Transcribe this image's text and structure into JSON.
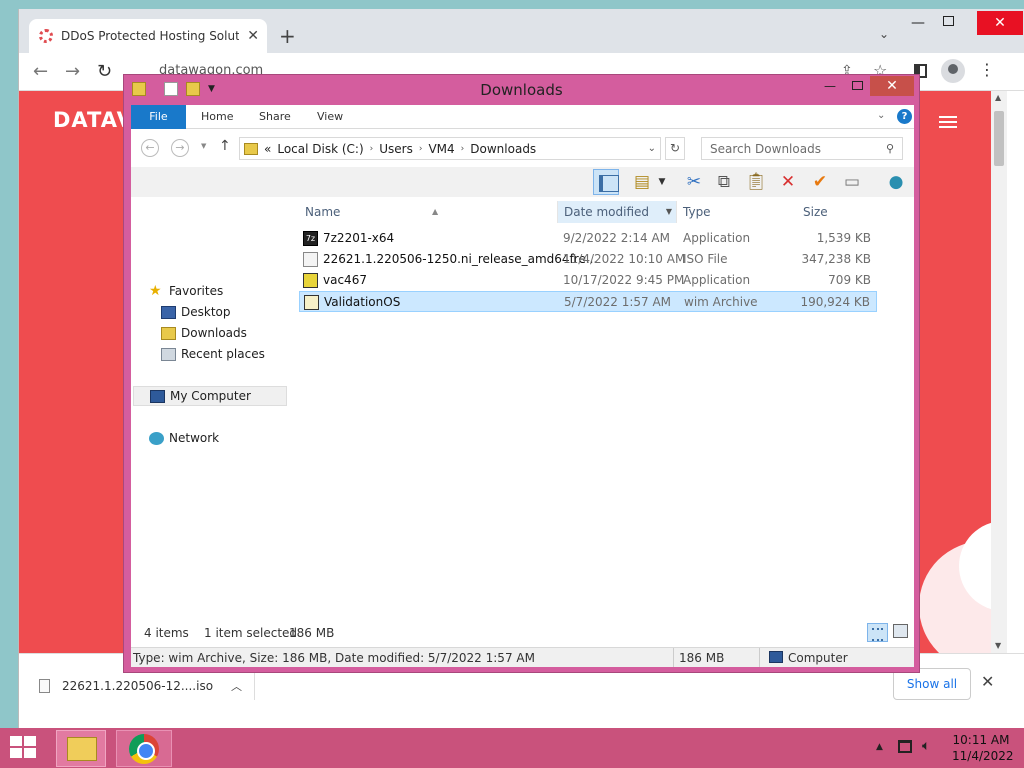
{
  "browser": {
    "tab_title": "DDoS Protected Hosting Solution",
    "tab_close": "✕",
    "new_tab": "+",
    "address": "datawagon.com",
    "site_logo": "DATAV"
  },
  "downloads_bar": {
    "file_name": "22621.1.220506-12....iso",
    "show_all": "Show all",
    "close": "✕"
  },
  "explorer": {
    "title": "Downloads",
    "ribbon_tabs": [
      "File",
      "Home",
      "Share",
      "View"
    ],
    "help": "?",
    "breadcrumb": {
      "prefix": "«",
      "items": [
        "Local Disk (C:)",
        "Users",
        "VM4",
        "Downloads"
      ]
    },
    "search_placeholder": "Search Downloads",
    "nav": {
      "favorites": "Favorites",
      "desktop": "Desktop",
      "downloads": "Downloads",
      "recent": "Recent places",
      "my_computer": "My Computer",
      "network": "Network"
    },
    "columns": {
      "name": "Name",
      "date": "Date modified",
      "type": "Type",
      "size": "Size"
    },
    "files": [
      {
        "name": "7z2201-x64",
        "date": "9/2/2022 2:14 AM",
        "type": "Application",
        "size": "1,539 KB"
      },
      {
        "name": "22621.1.220506-1250.ni_release_amd64fre...",
        "date": "11/4/2022 10:10 AM",
        "type": "ISO File",
        "size": "347,238 KB"
      },
      {
        "name": "vac467",
        "date": "10/17/2022 9:45 PM",
        "type": "Application",
        "size": "709 KB"
      },
      {
        "name": "ValidationOS",
        "date": "5/7/2022 1:57 AM",
        "type": "wim Archive",
        "size": "190,924 KB"
      }
    ],
    "status": {
      "item_count": "4 items",
      "selected": "1 item selected",
      "selected_size": "186 MB"
    },
    "info_bar": {
      "details": "Type: wim Archive, Size: 186 MB, Date modified: 5/7/2022 1:57 AM",
      "size": "186 MB",
      "location": "Computer"
    }
  },
  "taskbar": {
    "time": "10:11 AM",
    "date": "11/4/2022"
  },
  "colors": {
    "accent_window": "#d45d9e",
    "taskbar": "#c9527c",
    "ribbon_file": "#1979ca",
    "selection": "#cce8ff",
    "site_red": "#ef4c4f"
  }
}
